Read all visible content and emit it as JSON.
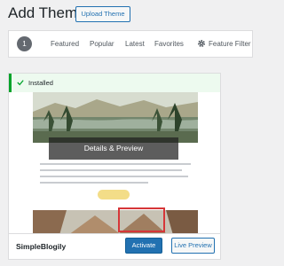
{
  "page": {
    "title": "Add Themes",
    "upload_label": "Upload Theme"
  },
  "filters": {
    "count": "1",
    "featured": "Featured",
    "popular": "Popular",
    "latest": "Latest",
    "favorites": "Favorites",
    "feature_filter": "Feature Filter"
  },
  "theme": {
    "installed_label": "Installed",
    "details_label": "Details & Preview",
    "name": "SimpleBlogily",
    "activate_label": "Activate",
    "preview_label": "Live Preview"
  },
  "colors": {
    "accent": "#2271b1",
    "success": "#00a32a",
    "highlight": "#d63638"
  }
}
